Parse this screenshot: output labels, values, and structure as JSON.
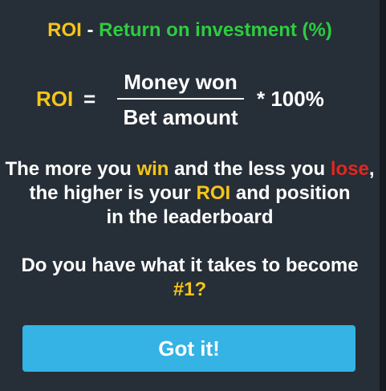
{
  "title": {
    "term": "ROI",
    "separator": " - ",
    "definition": "Return on investment (%)"
  },
  "formula": {
    "lhs": "ROI",
    "equals": "=",
    "numerator": "Money won",
    "denominator": "Bet amount",
    "multiplier": "* 100%"
  },
  "description": {
    "l1_a": "The more you ",
    "l1_win": "win",
    "l1_b": " and the less you ",
    "l1_lose": "lose",
    "l1_c": ",",
    "l2_a": "the higher is your ",
    "l2_roi": "ROI",
    "l2_b": " and position",
    "l3": "in the leaderboard"
  },
  "challenge": {
    "line1": "Do you have what it takes to become",
    "rank": "#1?"
  },
  "button": {
    "label": "Got it!"
  },
  "colors": {
    "background": "#262e37",
    "yellow": "#f5c518",
    "green": "#2ecc40",
    "red": "#e3261f",
    "button": "#34b3e4"
  }
}
